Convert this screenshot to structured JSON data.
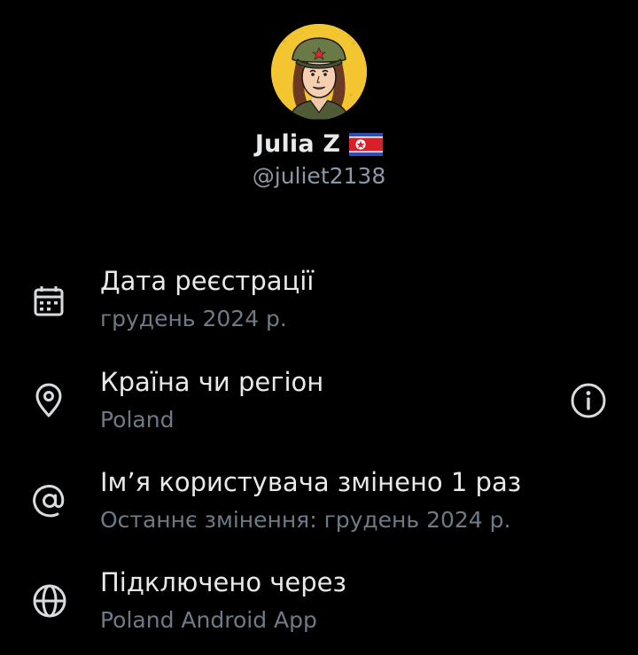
{
  "profile": {
    "display_name": "Julia Z",
    "flag_icon": "north-korea-flag-icon",
    "handle": "@juliet2138",
    "avatar_icon": "cartoon-woman-avatar"
  },
  "about": {
    "items": [
      {
        "icon": "calendar-icon",
        "title": "Дата реєстрації",
        "subtitle": "грудень 2024 р."
      },
      {
        "icon": "location-pin-icon",
        "title": "Країна чи регіон",
        "subtitle": "Poland",
        "action_icon": "info-icon"
      },
      {
        "icon": "at-sign-icon",
        "title": "Ім’я користувача змінено 1 раз",
        "subtitle": "Останнє змінення: грудень 2024 р."
      },
      {
        "icon": "globe-icon",
        "title": "Підключено через",
        "subtitle": "Poland Android App"
      }
    ]
  },
  "colors": {
    "background": "#000000",
    "primary_text": "#e7e9ea",
    "secondary_text": "#6e7b87",
    "handle_text": "#8b98a5",
    "icon": "#d9dcdf"
  }
}
